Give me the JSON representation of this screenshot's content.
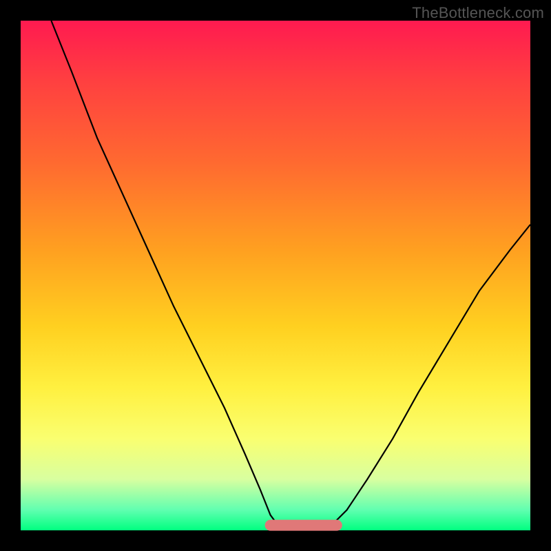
{
  "watermark": {
    "text": "TheBottleneck.com"
  },
  "colors": {
    "background": "#000000",
    "gradient_top": "#ff1a50",
    "gradient_mid": "#ffd020",
    "gradient_bottom": "#00ff80",
    "curve": "#000000",
    "bottom_marker": "#e07878"
  },
  "chart_data": {
    "type": "line",
    "title": "",
    "xlabel": "",
    "ylabel": "",
    "xlim": [
      0,
      100
    ],
    "ylim": [
      0,
      100
    ],
    "grid": false,
    "legend": false,
    "series": [
      {
        "name": "left-branch",
        "x": [
          6,
          10,
          15,
          20,
          25,
          30,
          35,
          40,
          44,
          47,
          49,
          50.5
        ],
        "values": [
          100,
          90,
          77,
          66,
          55,
          44,
          34,
          24,
          15,
          8,
          3,
          1
        ]
      },
      {
        "name": "flat-bottom",
        "x": [
          50.5,
          53,
          56,
          59,
          61
        ],
        "values": [
          1,
          0.6,
          0.5,
          0.6,
          1
        ]
      },
      {
        "name": "right-branch",
        "x": [
          61,
          64,
          68,
          73,
          78,
          84,
          90,
          96,
          100
        ],
        "values": [
          1,
          4,
          10,
          18,
          27,
          37,
          47,
          55,
          60
        ]
      }
    ],
    "annotations": [
      {
        "name": "bottom-highlight",
        "shape": "rounded-bar",
        "x_range": [
          49,
          62
        ],
        "y": 1,
        "color": "#e07878"
      }
    ]
  }
}
